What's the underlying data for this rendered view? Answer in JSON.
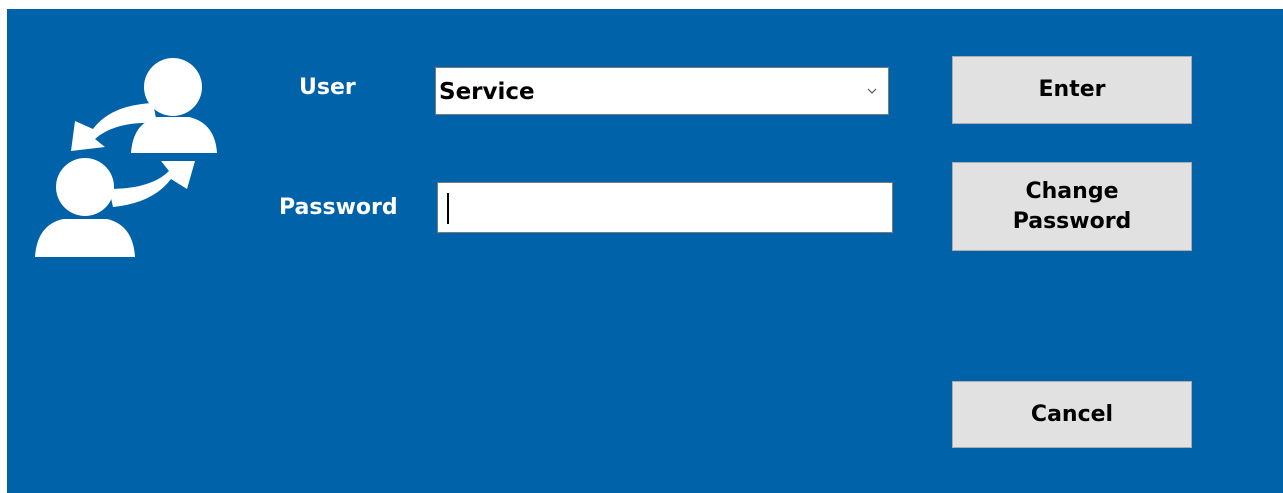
{
  "form": {
    "user_label": "User",
    "password_label": "Password",
    "user_select": {
      "selected": "Service"
    },
    "password_input": {
      "value": "",
      "placeholder": ""
    }
  },
  "buttons": {
    "enter": "Enter",
    "change_password": "Change Password",
    "cancel": "Cancel"
  },
  "icons": {
    "logo": "user-switch-icon",
    "dropdown": "chevron-down-icon"
  },
  "colors": {
    "background": "#0062a8",
    "button_face": "#e1e1e1",
    "label_text": "#ffffff"
  }
}
